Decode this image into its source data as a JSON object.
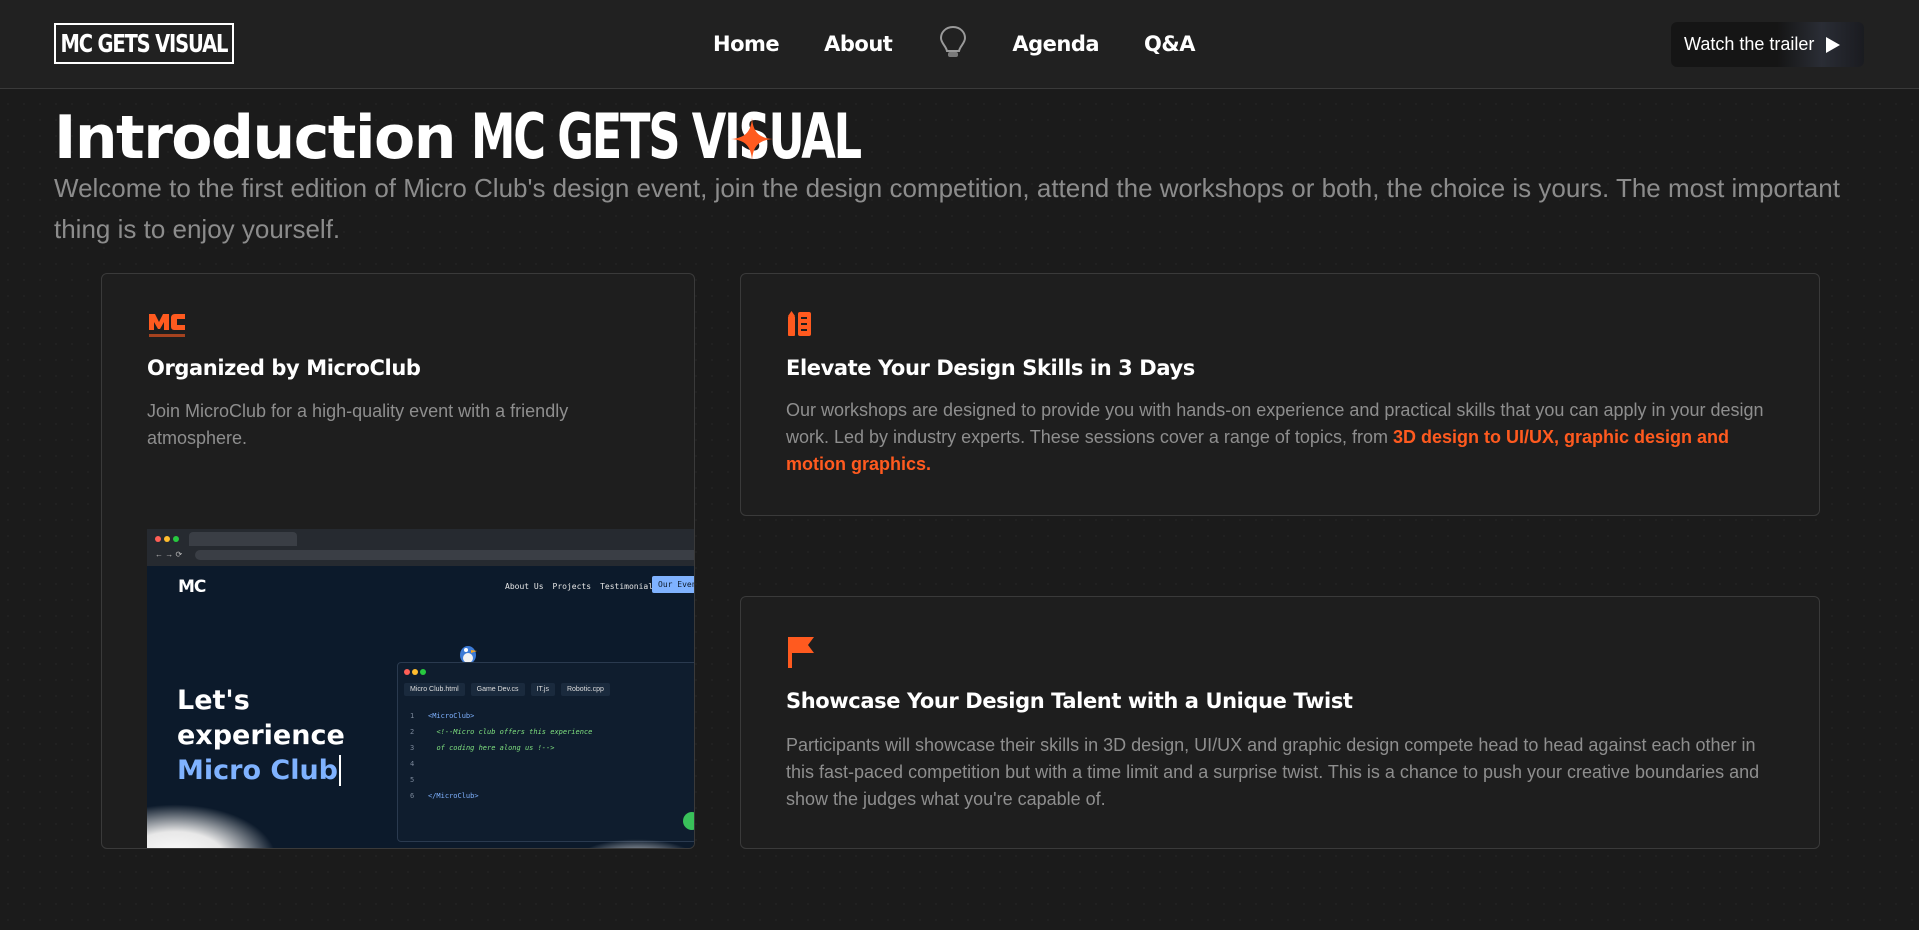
{
  "nav": {
    "logo": "MC GETS VISUAL",
    "items": [
      "Home",
      "About",
      "Agenda",
      "Q&A"
    ],
    "center_icon": "lightbulb-icon",
    "trailer_label": "Watch the trailer",
    "trailer_icon": "play-icon"
  },
  "intro": {
    "heading": "Introduction",
    "brand": "MC GETS VISUAL",
    "spark_icon": "sparkle-icon",
    "spark_color": "#ff5a1f",
    "lead": "Welcome to the first edition of Micro Club's design event, join the design competition, attend the workshops or both, the choice is yours. The most important thing is to enjoy yourself."
  },
  "cards": [
    {
      "icon": "microclub-logo-icon",
      "title": "Organized by MicroClub",
      "text": "Join MicroClub for a high-quality event with a friendly atmosphere."
    },
    {
      "icon": "pencil-ruler-icon",
      "title": "Elevate Your Design Skills in 3 Days",
      "text": "Our workshops are designed to provide you with hands-on experience and practical skills that you can apply in your design work. Led by industry experts. These sessions cover a range of topics, from ",
      "highlight": "3D design to UI/UX, graphic design and motion graphics."
    },
    {
      "icon": "flag-icon",
      "title": "Showcase Your Design Talent with a Unique Twist",
      "text": "Participants will showcase their skills in 3D design, UI/UX and graphic design compete head to head against each other in this fast-paced competition but with a time limit and a surprise twist. This is a chance to push your creative boundaries and show the judges what you're capable of."
    }
  ],
  "preview": {
    "site_logo": "MC",
    "links": [
      "About Us",
      "Projects",
      "Testimonials"
    ],
    "cta": "Our Even",
    "hero_line1": "Let's",
    "hero_line2": "experience",
    "hero_line3": "Micro Club",
    "editor_tabs": [
      "Micro Club.html",
      "Game Dev.cs",
      "IT.js",
      "Robotic.cpp"
    ],
    "code": [
      "<MicroClub>",
      "<!--Micro club offers this experience",
      "of coding here along us !-->",
      "",
      "",
      "</MicroClub>"
    ]
  },
  "colors": {
    "accent": "#ff5a1f",
    "background": "#1b1b1b",
    "card": "#1e1e1e"
  }
}
